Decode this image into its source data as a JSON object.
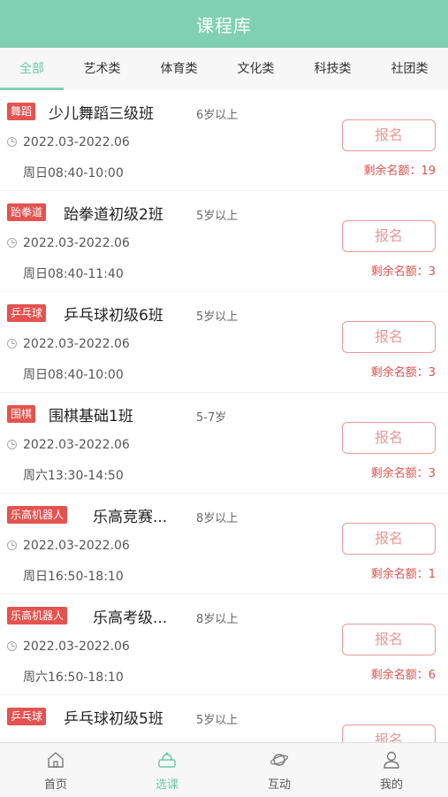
{
  "header": {
    "title": "课程库"
  },
  "tabs": [
    {
      "label": "全部",
      "active": true
    },
    {
      "label": "艺术类"
    },
    {
      "label": "体育类"
    },
    {
      "label": "文化类"
    },
    {
      "label": "科技类"
    },
    {
      "label": "社团类"
    }
  ],
  "courses": [
    {
      "tag": "舞蹈",
      "name": "少儿舞蹈三级班",
      "age": "6岁以上",
      "date": "2022.03-2022.06",
      "time": "周日08:40-10:00",
      "button": "报名",
      "remaining": "剩余名额：19"
    },
    {
      "tag": "跆拳道",
      "name": "跆拳道初级2班",
      "age": "5岁以上",
      "date": "2022.03-2022.06",
      "time": "周日08:40-11:40",
      "button": "报名",
      "remaining": "剩余名额：3"
    },
    {
      "tag": "乒乓球",
      "name": "乒乓球初级6班",
      "age": "5岁以上",
      "date": "2022.03-2022.06",
      "time": "周日08:40-10:00",
      "button": "报名",
      "remaining": "剩余名额：3"
    },
    {
      "tag": "围棋",
      "name": "围棋基础1班",
      "age": "5-7岁",
      "date": "2022.03-2022.06",
      "time": "周六13:30-14:50",
      "button": "报名",
      "remaining": "剩余名额：3"
    },
    {
      "tag": "乐高机器人",
      "name": "乐高竞赛...",
      "age": "8岁以上",
      "date": "2022.03-2022.06",
      "time": "周日16:50-18:10",
      "button": "报名",
      "remaining": "剩余名额：1"
    },
    {
      "tag": "乐高机器人",
      "name": "乐高考级...",
      "age": "8岁以上",
      "date": "2022.03-2022.06",
      "time": "周六16:50-18:10",
      "button": "报名",
      "remaining": "剩余名额：6"
    },
    {
      "tag": "乒乓球",
      "name": "乒乓球初级5班",
      "age": "5岁以上",
      "date": "",
      "time": "",
      "button": "报名",
      "remaining": ""
    }
  ],
  "bottom_nav": [
    {
      "label": "首页",
      "icon": "home-icon"
    },
    {
      "label": "选课",
      "icon": "course-select-icon",
      "active": true
    },
    {
      "label": "互动",
      "icon": "planet-icon"
    },
    {
      "label": "我的",
      "icon": "user-icon"
    }
  ],
  "colors": {
    "header": "#7fd1b2",
    "accent": "#6dc9a6",
    "tag": "#e4534f",
    "button": "#e89a98"
  }
}
